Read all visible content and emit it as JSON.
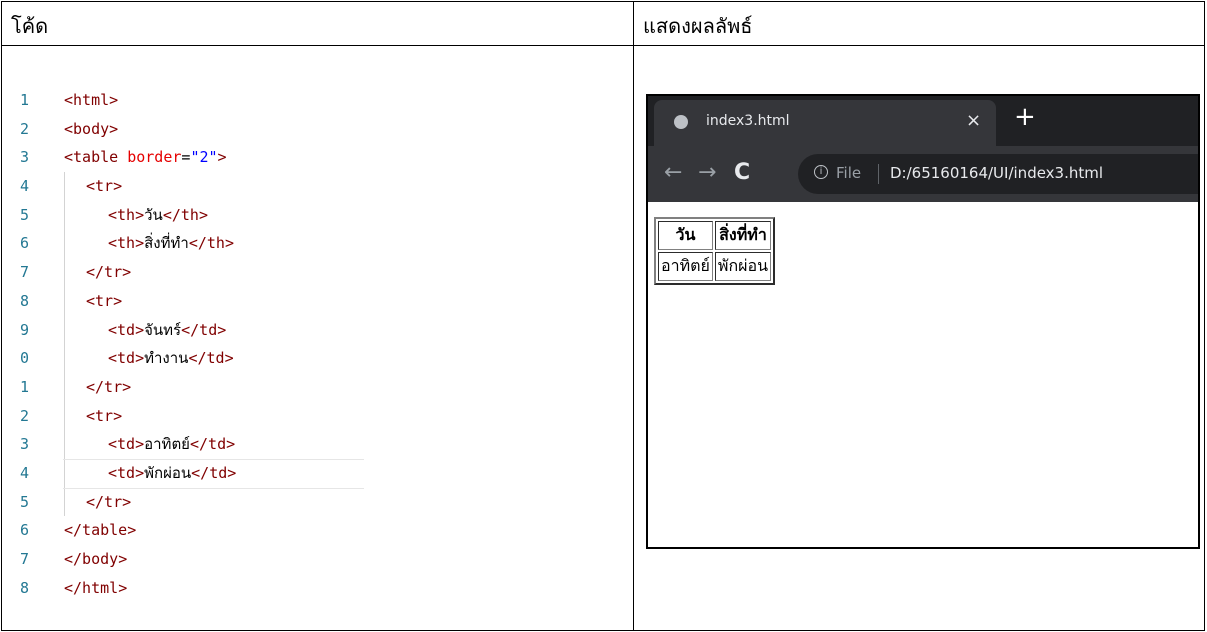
{
  "header": {
    "code_label": "โค้ด",
    "result_label": "แสดงผลลัพธ์"
  },
  "code_lines": [
    {
      "num": "1",
      "text": "<html>"
    },
    {
      "num": "2",
      "text": "<body>"
    },
    {
      "num": "3",
      "text": "<table border=\"2\">"
    },
    {
      "num": "4",
      "text": "<tr>"
    },
    {
      "num": "5",
      "text": "<th>วัน</th>"
    },
    {
      "num": "6",
      "text": "<th>สิ่งที่ทำ</th>"
    },
    {
      "num": "7",
      "text": "</tr>"
    },
    {
      "num": "8",
      "text": "<tr>"
    },
    {
      "num": "9",
      "text": "<td>จันทร์</td>"
    },
    {
      "num": "0",
      "text": "<td>ทำงาน</td>"
    },
    {
      "num": "1",
      "text": "</tr>"
    },
    {
      "num": "2",
      "text": "<tr>"
    },
    {
      "num": "3",
      "text": "<td>อาทิตย์</td>"
    },
    {
      "num": "4",
      "text": "<td>พักผ่อน</td>"
    },
    {
      "num": "5",
      "text": "</tr>"
    },
    {
      "num": "6",
      "text": "</table>"
    },
    {
      "num": "7",
      "text": "</body>"
    },
    {
      "num": "8",
      "text": "</html>"
    }
  ],
  "browser": {
    "tab_title": "index3.html",
    "tab_close": "×",
    "new_tab": "+",
    "back": "←",
    "forward": "→",
    "reload": "C",
    "info": "i",
    "file_label": "File",
    "url": "D:/65160164/UI/index3.html"
  },
  "rendered_table": {
    "headers": [
      "วัน",
      "สิ่งที่ทำ"
    ],
    "row": [
      "อาทิตย์",
      "พักผ่อน"
    ]
  }
}
